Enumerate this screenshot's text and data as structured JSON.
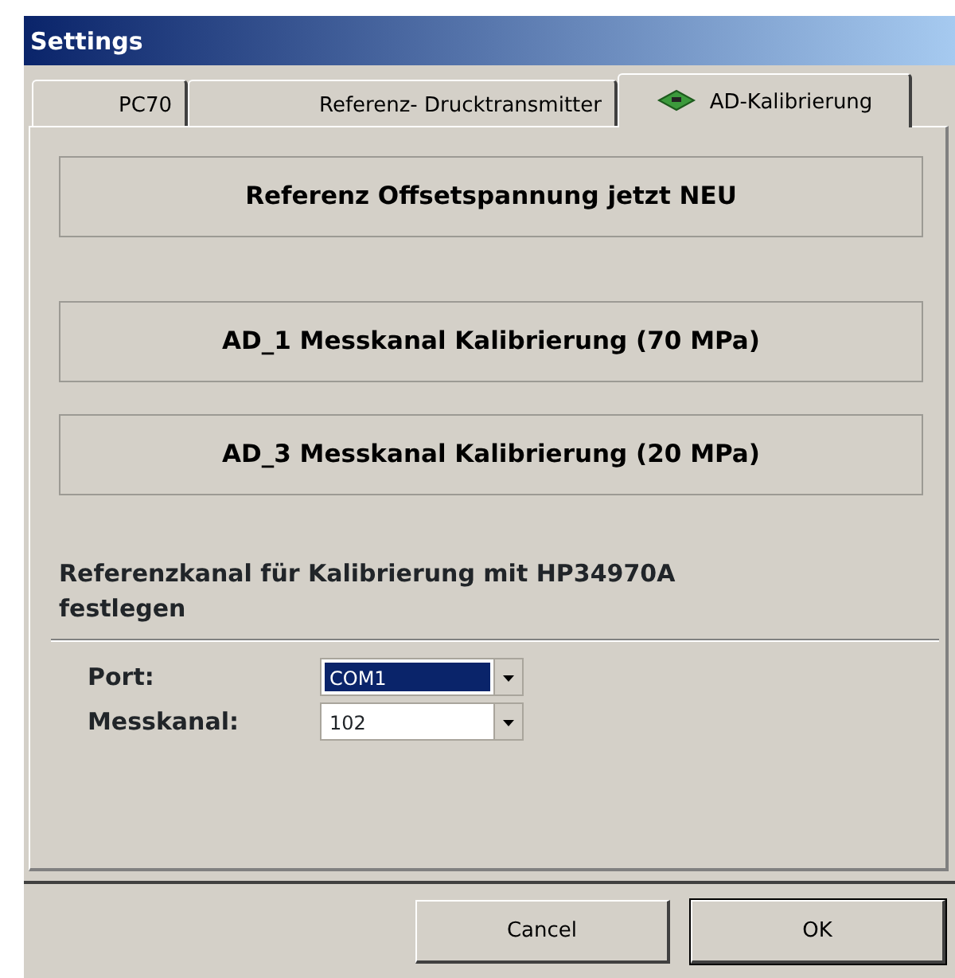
{
  "window": {
    "title": "Settings"
  },
  "tabs": [
    {
      "label": "PC70",
      "selected": false,
      "icon": false
    },
    {
      "label": "Referenz- Drucktransmitter",
      "selected": false,
      "icon": false
    },
    {
      "label": "AD-Kalibrierung",
      "selected": true,
      "icon": true
    }
  ],
  "action_buttons": [
    "Referenz Offsetspannung jetzt NEU",
    "AD_1 Messkanal Kalibrierung (70 MPa)",
    "AD_3 Messkanal Kalibrierung (20 MPa)"
  ],
  "section_heading": "Referenzkanal für Kalibrierung mit HP34970A festlegen",
  "fields": [
    {
      "label": "Port:",
      "value": "COM1",
      "focused": true
    },
    {
      "label": "Messkanal:",
      "value": "102",
      "focused": false
    }
  ],
  "buttons": [
    {
      "label": "Cancel",
      "default": false
    },
    {
      "label": "OK",
      "default": true
    }
  ]
}
